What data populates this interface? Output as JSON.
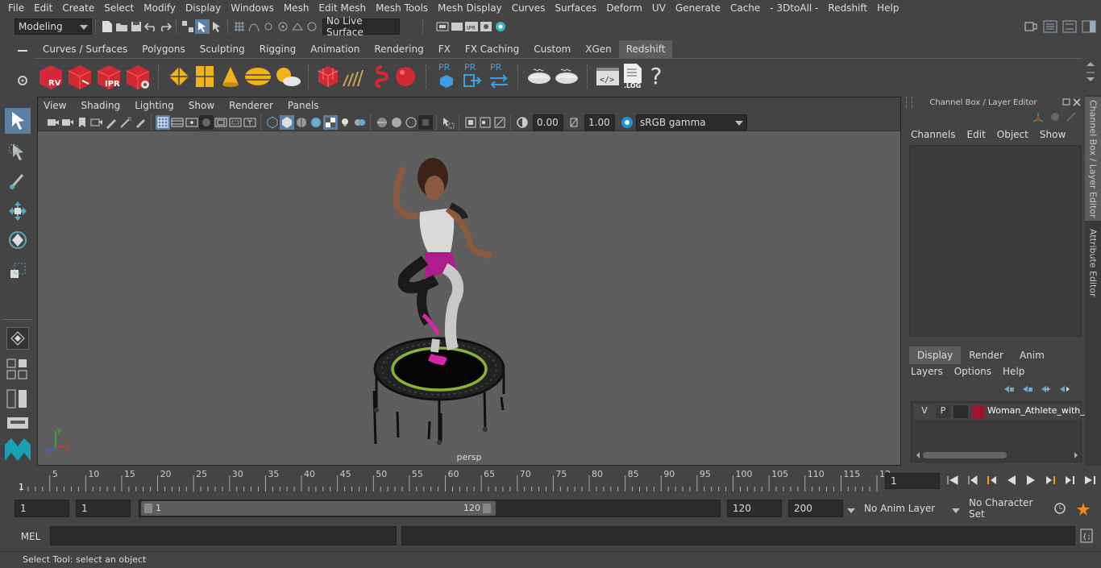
{
  "menubar": [
    "File",
    "Edit",
    "Create",
    "Select",
    "Modify",
    "Display",
    "Windows",
    "Mesh",
    "Edit Mesh",
    "Mesh Tools",
    "Mesh Display",
    "Curves",
    "Surfaces",
    "Deform",
    "UV",
    "Generate",
    "Cache",
    "- 3DtoAll -",
    "Redshift",
    "Help"
  ],
  "status": {
    "workspace": "Modeling",
    "live_surface": "No Live Surface"
  },
  "shelf": {
    "tabs": [
      "Curves / Surfaces",
      "Polygons",
      "Sculpting",
      "Rigging",
      "Animation",
      "Rendering",
      "FX",
      "FX Caching",
      "Custom",
      "XGen",
      "Redshift"
    ],
    "active": "Redshift",
    "labels": {
      "rv": "RV",
      "ipr": "IPR",
      "pr": "PR",
      "log": ".LOG",
      "help": "?"
    }
  },
  "viewport": {
    "menu": [
      "View",
      "Shading",
      "Lighting",
      "Show",
      "Renderer",
      "Panels"
    ],
    "exposure": "0.00",
    "gamma": "1.00",
    "colorspace": "sRGB gamma",
    "camera": "persp"
  },
  "channel_box": {
    "title": "Channel Box / Layer Editor",
    "menu": [
      "Channels",
      "Edit",
      "Object",
      "Show"
    ],
    "layer_tabs": [
      "Display",
      "Render",
      "Anim"
    ],
    "active_layer_tab": "Display",
    "layer_menu": [
      "Layers",
      "Options",
      "Help"
    ],
    "layer": {
      "v": "V",
      "p": "P",
      "name": "Woman_Athlete_with_",
      "color": "#9b1730"
    }
  },
  "side_tabs": [
    "Channel Box / Layer Editor",
    "Attribute Editor"
  ],
  "timeline": {
    "ticks": [
      "5",
      "10",
      "15",
      "20",
      "25",
      "30",
      "35",
      "40",
      "45",
      "50",
      "55",
      "60",
      "65",
      "70",
      "75",
      "80",
      "85",
      "90",
      "95",
      "100",
      "105",
      "110",
      "115",
      "12"
    ],
    "start_marker": "1",
    "current_frame": "1"
  },
  "range": {
    "start": "1",
    "anim_start": "1",
    "slider_start": "1",
    "slider_end": "120",
    "end": "120",
    "anim_end": "200",
    "anim_layer": "No Anim Layer",
    "char_set": "No Character Set"
  },
  "cmd": {
    "lang": "MEL"
  },
  "help": "Select Tool: select an object"
}
